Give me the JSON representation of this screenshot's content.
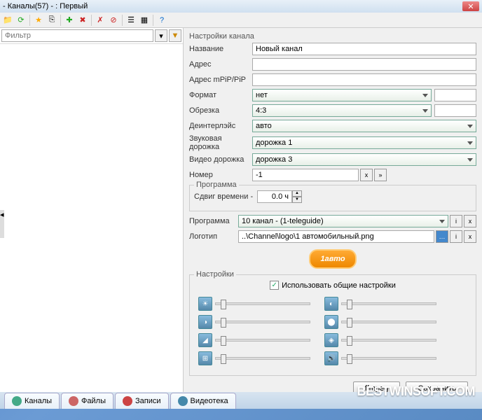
{
  "window": {
    "title": "- Каналы(57) -  : Первый"
  },
  "toolbar_icons": [
    "folder",
    "refresh",
    "star",
    "copy",
    "add",
    "delete",
    "sep",
    "cancel",
    "stop",
    "sep",
    "list",
    "grid",
    "sep",
    "help"
  ],
  "filter": {
    "placeholder": "Фильтр"
  },
  "settings": {
    "header": "Настройки канала",
    "name_label": "Название",
    "name_value": "Новый канал",
    "address_label": "Адрес",
    "addr_mpip_label": "Адрес mPiP/PiP",
    "format_label": "Формат",
    "format_value": "нет",
    "crop_label": "Обрезка",
    "crop_value": "4:3",
    "deint_label": "Деинтерлэйс",
    "deint_value": "авто",
    "audio_label": "Звуковая дорожка",
    "audio_value": "дорожка 1",
    "video_label": "Видео дорожка",
    "video_value": "дорожка 3",
    "number_label": "Номер",
    "number_value": "-1",
    "program_group": "Программа",
    "shift_label": "Сдвиг времени -",
    "shift_value": "0.0 ч",
    "program_label": "Программа",
    "program_value": "10 канал - (1-teleguide)",
    "logo_label": "Логотип",
    "logo_value": "..\\Channel\\logo\\1 автомобильный.png",
    "logo_text": "1авто",
    "settings_group": "Настройки",
    "use_common": "Использовать общие настройки"
  },
  "sliders": [
    "brightness",
    "contrast",
    "gamma",
    "scale",
    "hue",
    "saturation",
    "sharpness",
    "volume"
  ],
  "buttons": {
    "ffmpeg": "ffmpeg",
    "save": "Сохранить"
  },
  "tabs": [
    {
      "label": "Каналы",
      "color": "#4a8"
    },
    {
      "label": "Файлы",
      "color": "#c66"
    },
    {
      "label": "Записи",
      "color": "#c44"
    },
    {
      "label": "Видеотека",
      "color": "#48a"
    }
  ],
  "watermark": "BESTWINSOFT.COM"
}
